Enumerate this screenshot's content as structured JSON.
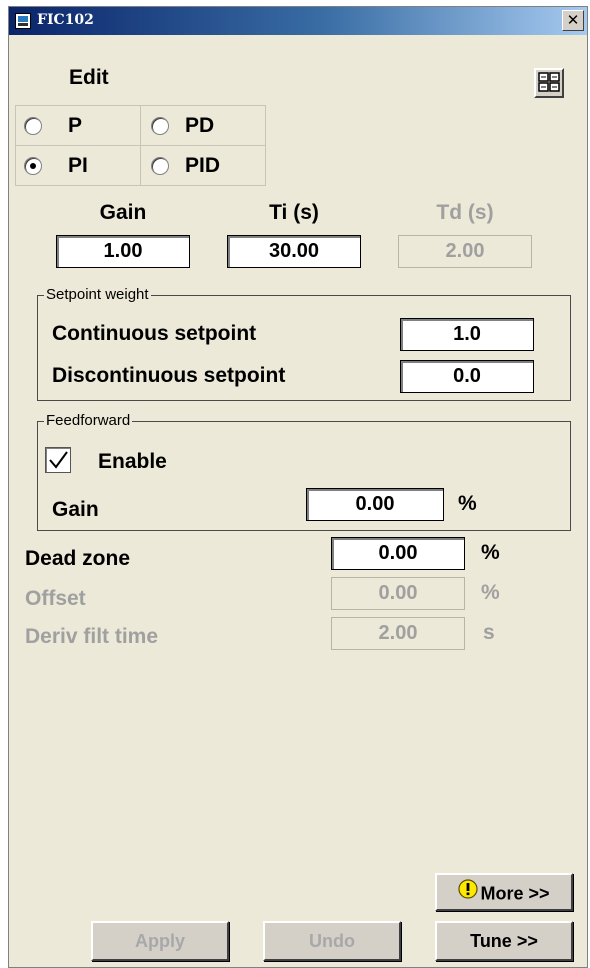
{
  "window": {
    "title": "FIC102",
    "close_glyph": "✕"
  },
  "edit_label": "Edit",
  "modes": [
    {
      "label": "P",
      "selected": false
    },
    {
      "label": "PD",
      "selected": false
    },
    {
      "label": "PI",
      "selected": true
    },
    {
      "label": "PID",
      "selected": false
    }
  ],
  "tuning": {
    "gain": {
      "label": "Gain",
      "value": "1.00",
      "enabled": true
    },
    "ti": {
      "label": "Ti (s)",
      "value": "30.00",
      "enabled": true
    },
    "td": {
      "label": "Td (s)",
      "value": "2.00",
      "enabled": false
    }
  },
  "setpoint_weight": {
    "title": "Setpoint weight",
    "continuous": {
      "label": "Continuous setpoint",
      "value": "1.0"
    },
    "discontinuous": {
      "label": "Discontinuous setpoint",
      "value": "0.0"
    }
  },
  "feedforward": {
    "title": "Feedforward",
    "enable": {
      "label": "Enable",
      "checked": true
    },
    "gain": {
      "label": "Gain",
      "value": "0.00",
      "unit": "%"
    }
  },
  "dead_zone": {
    "label": "Dead zone",
    "value": "0.00",
    "unit": "%",
    "enabled": true
  },
  "offset": {
    "label": "Offset",
    "value": "0.00",
    "unit": "%",
    "enabled": false
  },
  "deriv_filt_time": {
    "label": "Deriv filt time",
    "value": "2.00",
    "unit": "s",
    "enabled": false
  },
  "buttons": {
    "more": "More >>",
    "apply": "Apply",
    "undo": "Undo",
    "tune": "Tune >>"
  },
  "icons": {
    "title": "faceplate-icon",
    "pane": "grid-view-icon",
    "more": "warning-icon",
    "check": "checkmark-icon"
  },
  "colors": {
    "window_bg": "#ece9d8",
    "titlebar_start": "#0a246a",
    "titlebar_end": "#a6caf0",
    "disabled_text": "#a0a0a0",
    "warning_yellow": "#ffe800"
  }
}
